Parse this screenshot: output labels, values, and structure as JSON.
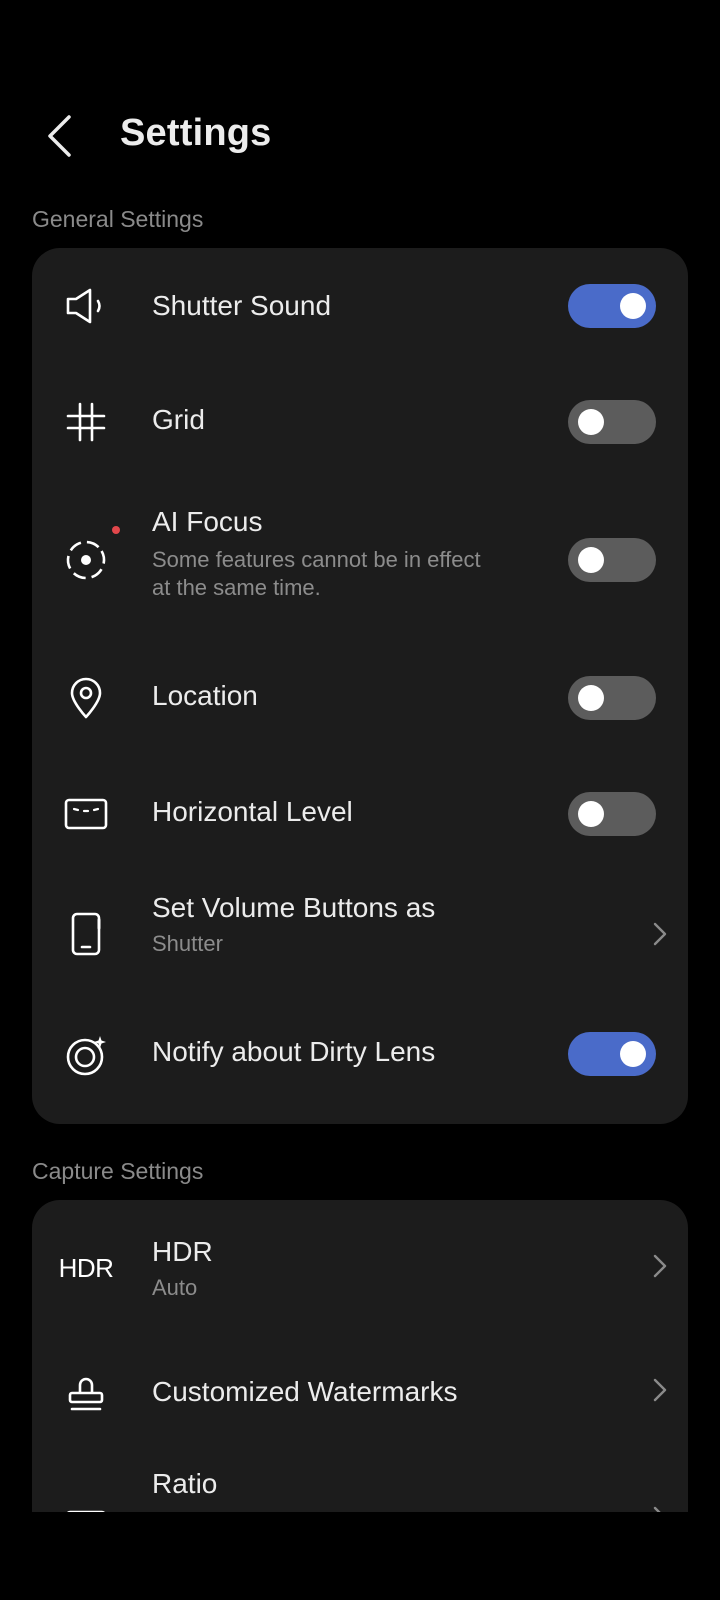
{
  "header": {
    "title": "Settings",
    "back_icon": "chevron-left-icon"
  },
  "general": {
    "label": "General Settings",
    "items": [
      {
        "title": "Shutter Sound",
        "icon": "speaker-icon",
        "control": "toggle",
        "on": true
      },
      {
        "title": "Grid",
        "icon": "grid-icon",
        "control": "toggle",
        "on": false
      },
      {
        "title": "AI Focus",
        "subtitle_line1": "Some features cannot be in effect",
        "subtitle_line2": "at the same time.",
        "icon": "ai-focus-icon",
        "control": "toggle",
        "on": false
      },
      {
        "title": "Location",
        "icon": "location-pin-icon",
        "control": "toggle",
        "on": false
      },
      {
        "title": "Horizontal Level",
        "icon": "horizontal-level-icon",
        "control": "toggle",
        "on": false
      },
      {
        "title": "Set Volume Buttons as",
        "subtitle": "Shutter",
        "icon": "phone-icon",
        "control": "chevron"
      },
      {
        "title": "Notify about Dirty Lens",
        "icon": "lens-sparkle-icon",
        "control": "toggle",
        "on": true
      }
    ]
  },
  "capture": {
    "label": "Capture Settings",
    "items": [
      {
        "title": "HDR",
        "subtitle": "Auto",
        "icon_text": "HDR",
        "icon": "hdr-icon",
        "control": "chevron"
      },
      {
        "title": "Customized Watermarks",
        "icon": "stamp-icon",
        "control": "chevron"
      },
      {
        "title": "Ratio",
        "icon": "ratio-icon",
        "control": "chevron"
      }
    ]
  },
  "colors": {
    "background": "#000000",
    "card": "#1c1c1c",
    "toggle_on": "#4a6bc9",
    "toggle_off": "#5c5c5c",
    "notification_dot": "#e2474b"
  }
}
